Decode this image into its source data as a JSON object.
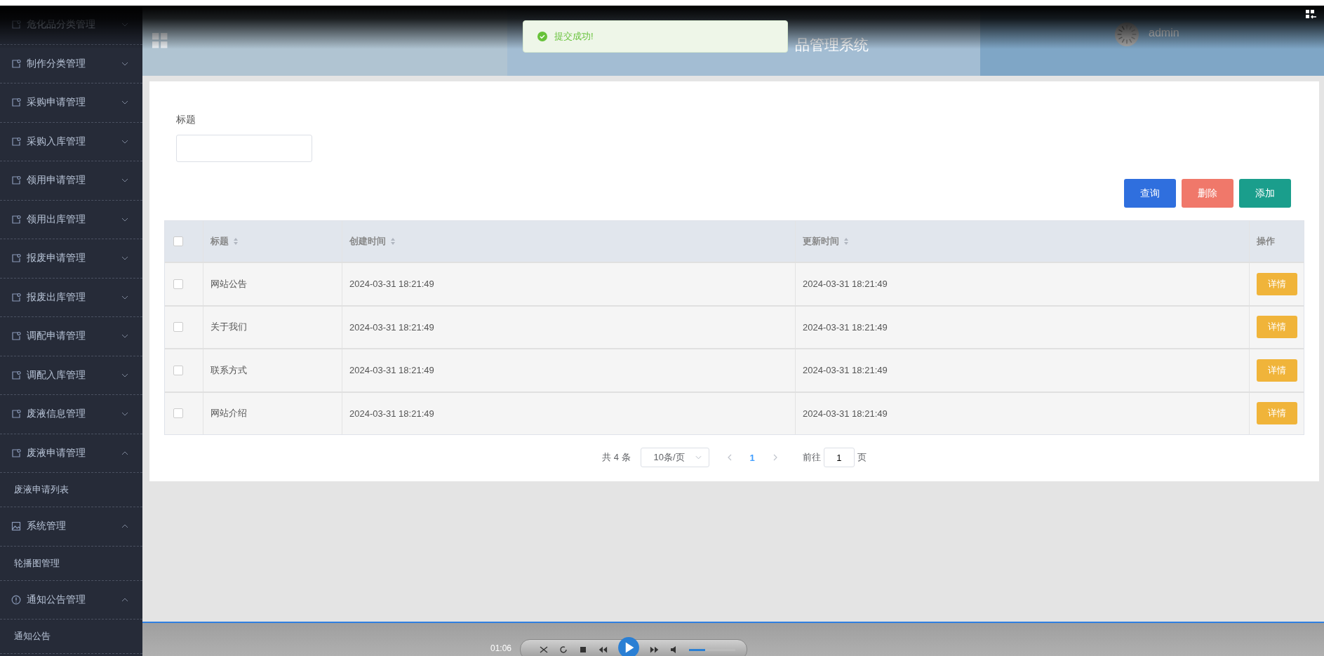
{
  "sidebar": {
    "items": [
      {
        "label": "危化品分类管理",
        "kind": "doc",
        "expanded": false
      },
      {
        "label": "制作分类管理",
        "kind": "doc",
        "expanded": false
      },
      {
        "label": "采购申请管理",
        "kind": "doc",
        "expanded": false
      },
      {
        "label": "采购入库管理",
        "kind": "doc",
        "expanded": false
      },
      {
        "label": "领用申请管理",
        "kind": "doc",
        "expanded": false
      },
      {
        "label": "领用出库管理",
        "kind": "doc",
        "expanded": false
      },
      {
        "label": "报废申请管理",
        "kind": "doc",
        "expanded": false
      },
      {
        "label": "报废出库管理",
        "kind": "doc",
        "expanded": false
      },
      {
        "label": "调配申请管理",
        "kind": "doc",
        "expanded": false
      },
      {
        "label": "调配入库管理",
        "kind": "doc",
        "expanded": false
      },
      {
        "label": "废液信息管理",
        "kind": "doc",
        "expanded": false
      },
      {
        "label": "废液申请管理",
        "kind": "doc",
        "expanded": true,
        "children": [
          {
            "label": "废液申请列表"
          }
        ]
      },
      {
        "label": "系统管理",
        "kind": "image",
        "expanded": true,
        "children": [
          {
            "label": "轮播图管理"
          }
        ]
      },
      {
        "label": "通知公告管理",
        "kind": "info",
        "expanded": true,
        "children": [
          {
            "label": "通知公告"
          }
        ]
      }
    ]
  },
  "header": {
    "title": "品管理系统",
    "user": "admin"
  },
  "toast": {
    "message": "提交成功!"
  },
  "search": {
    "label": "标题"
  },
  "buttons": [
    {
      "label": "查询",
      "kind": "search"
    },
    {
      "label": "删除",
      "kind": "delete"
    },
    {
      "label": "添加",
      "kind": "add"
    }
  ],
  "table": {
    "select_all": {
      "checked": false
    },
    "columns": [
      {
        "label": "标题",
        "sortable": true
      },
      {
        "label": "创建时间",
        "sortable": true
      },
      {
        "label": "更新时间",
        "sortable": true
      },
      {
        "label": "操作",
        "sortable": false
      }
    ],
    "rows": [
      {
        "checked": false,
        "cells": [
          "网站公告",
          "2024-03-31 18:21:49",
          "2024-03-31 18:21:49"
        ],
        "action": "详情"
      },
      {
        "checked": false,
        "cells": [
          "关于我们",
          "2024-03-31 18:21:49",
          "2024-03-31 18:21:49"
        ],
        "action": "详情"
      },
      {
        "checked": false,
        "cells": [
          "联系方式",
          "2024-03-31 18:21:49",
          "2024-03-31 18:21:49"
        ],
        "action": "详情"
      },
      {
        "checked": false,
        "cells": [
          "网站介绍",
          "2024-03-31 18:21:49",
          "2024-03-31 18:21:49"
        ],
        "action": "详情"
      }
    ]
  },
  "pagination": {
    "total": "共 4 条",
    "page_size": "10条/页",
    "current": "1",
    "goto": "前往",
    "goto_value": "1",
    "page_unit": "页"
  },
  "player": {
    "time": "01:06",
    "volume": {
      "level": 0.35
    }
  }
}
